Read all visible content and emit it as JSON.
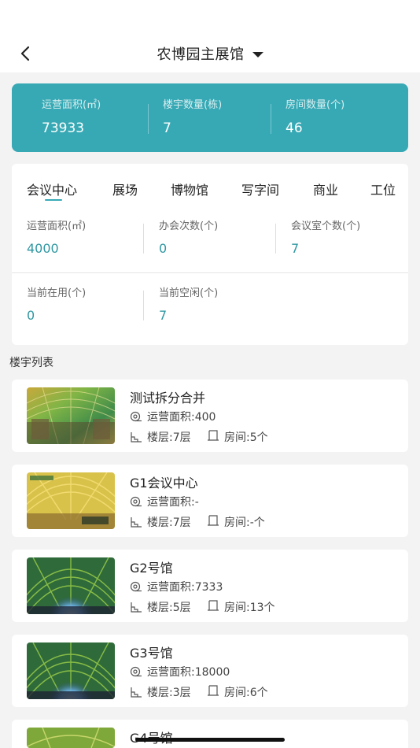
{
  "header": {
    "title": "农博园主展馆",
    "back_icon": "chevron-left-icon",
    "dropdown_icon": "caret-down-icon"
  },
  "summary": {
    "items": [
      {
        "label": "运营面积(㎡)",
        "value": "73933"
      },
      {
        "label": "楼宇数量(栋)",
        "value": "7"
      },
      {
        "label": "房间数量(个)",
        "value": "46"
      }
    ],
    "color": "#37a9b5"
  },
  "tabs": {
    "items": [
      "会议中心",
      "展场",
      "博物馆",
      "写字间",
      "商业",
      "工位"
    ],
    "active": "会议中心"
  },
  "stats": {
    "row1": [
      {
        "label": "运营面积(㎡)",
        "value": "4000"
      },
      {
        "label": "办会次数(个)",
        "value": "0"
      },
      {
        "label": "会议室个数(个)",
        "value": "7"
      }
    ],
    "row2": [
      {
        "label": "当前在用(个)",
        "value": "0"
      },
      {
        "label": "当前空闲(个)",
        "value": "7"
      }
    ]
  },
  "building_list": {
    "title": "楼宇列表",
    "items": [
      {
        "name": "测试拆分合并",
        "area": "运营面积:400",
        "floors": "楼层:7层",
        "rooms": "房间:5个"
      },
      {
        "name": "G1会议中心",
        "area": "运营面积:-",
        "floors": "楼层:7层",
        "rooms": "房间:-个"
      },
      {
        "name": "G2号馆",
        "area": "运营面积:7333",
        "floors": "楼层:5层",
        "rooms": "房间:13个"
      },
      {
        "name": "G3号馆",
        "area": "运营面积:18000",
        "floors": "楼层:3层",
        "rooms": "房间:6个"
      },
      {
        "name": "G4号馆"
      }
    ]
  },
  "icons": {
    "area": "area-icon",
    "floor": "floor-icon",
    "room": "room-icon"
  }
}
